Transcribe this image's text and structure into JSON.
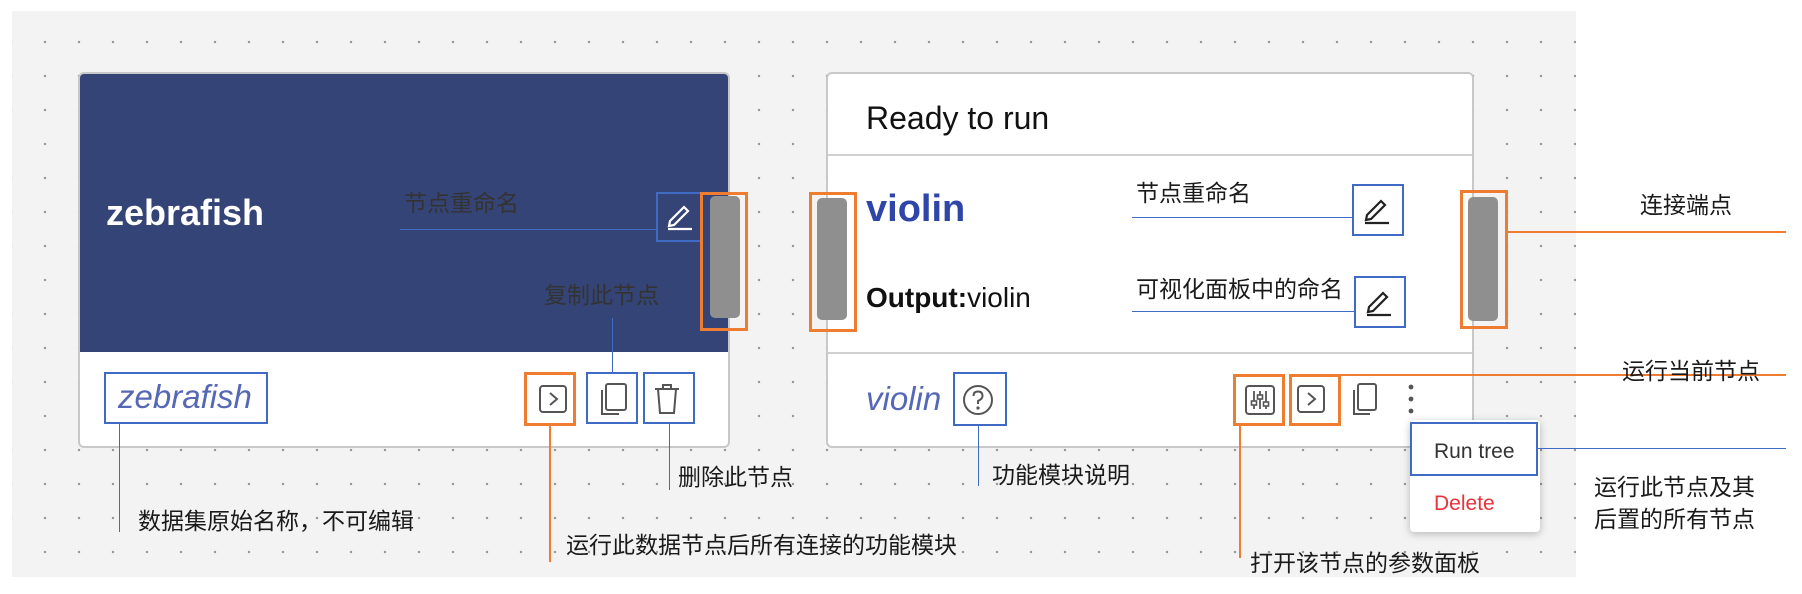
{
  "node_data": {
    "title": "zebrafish",
    "original_name": "zebrafish"
  },
  "node_func": {
    "status": "Ready to run",
    "title": "violin",
    "output_label": "Output:",
    "output_value": "violin",
    "module_name": "violin"
  },
  "menu": {
    "run_tree": "Run tree",
    "delete": "Delete"
  },
  "annotations": {
    "rename_left": "节点重命名",
    "copy_node": "复制此节点",
    "delete_node": "删除此节点",
    "dataset_name": "数据集原始名称，不可编辑",
    "run_data_node": "运行此数据节点后所有连接的功能模块",
    "rename_right": "节点重命名",
    "viz_name": "可视化面板中的命名",
    "module_help": "功能模块说明",
    "open_params": "打开该节点的参数面板",
    "connect_port": "连接端点",
    "run_current": "运行当前节点",
    "run_tree_desc_1": "运行此节点及其",
    "run_tree_desc_2": "后置的所有节点"
  },
  "colors": {
    "node_header": "#354476",
    "annotation_blue": "#3f6bc4",
    "annotation_orange": "#ee7d31",
    "delete_red": "#e8333b",
    "module_text": "#5567b5"
  },
  "icons": [
    "pencil-icon",
    "play-icon",
    "copy-icon",
    "trash-icon",
    "help-icon",
    "sliders-icon",
    "more-vertical-icon"
  ]
}
